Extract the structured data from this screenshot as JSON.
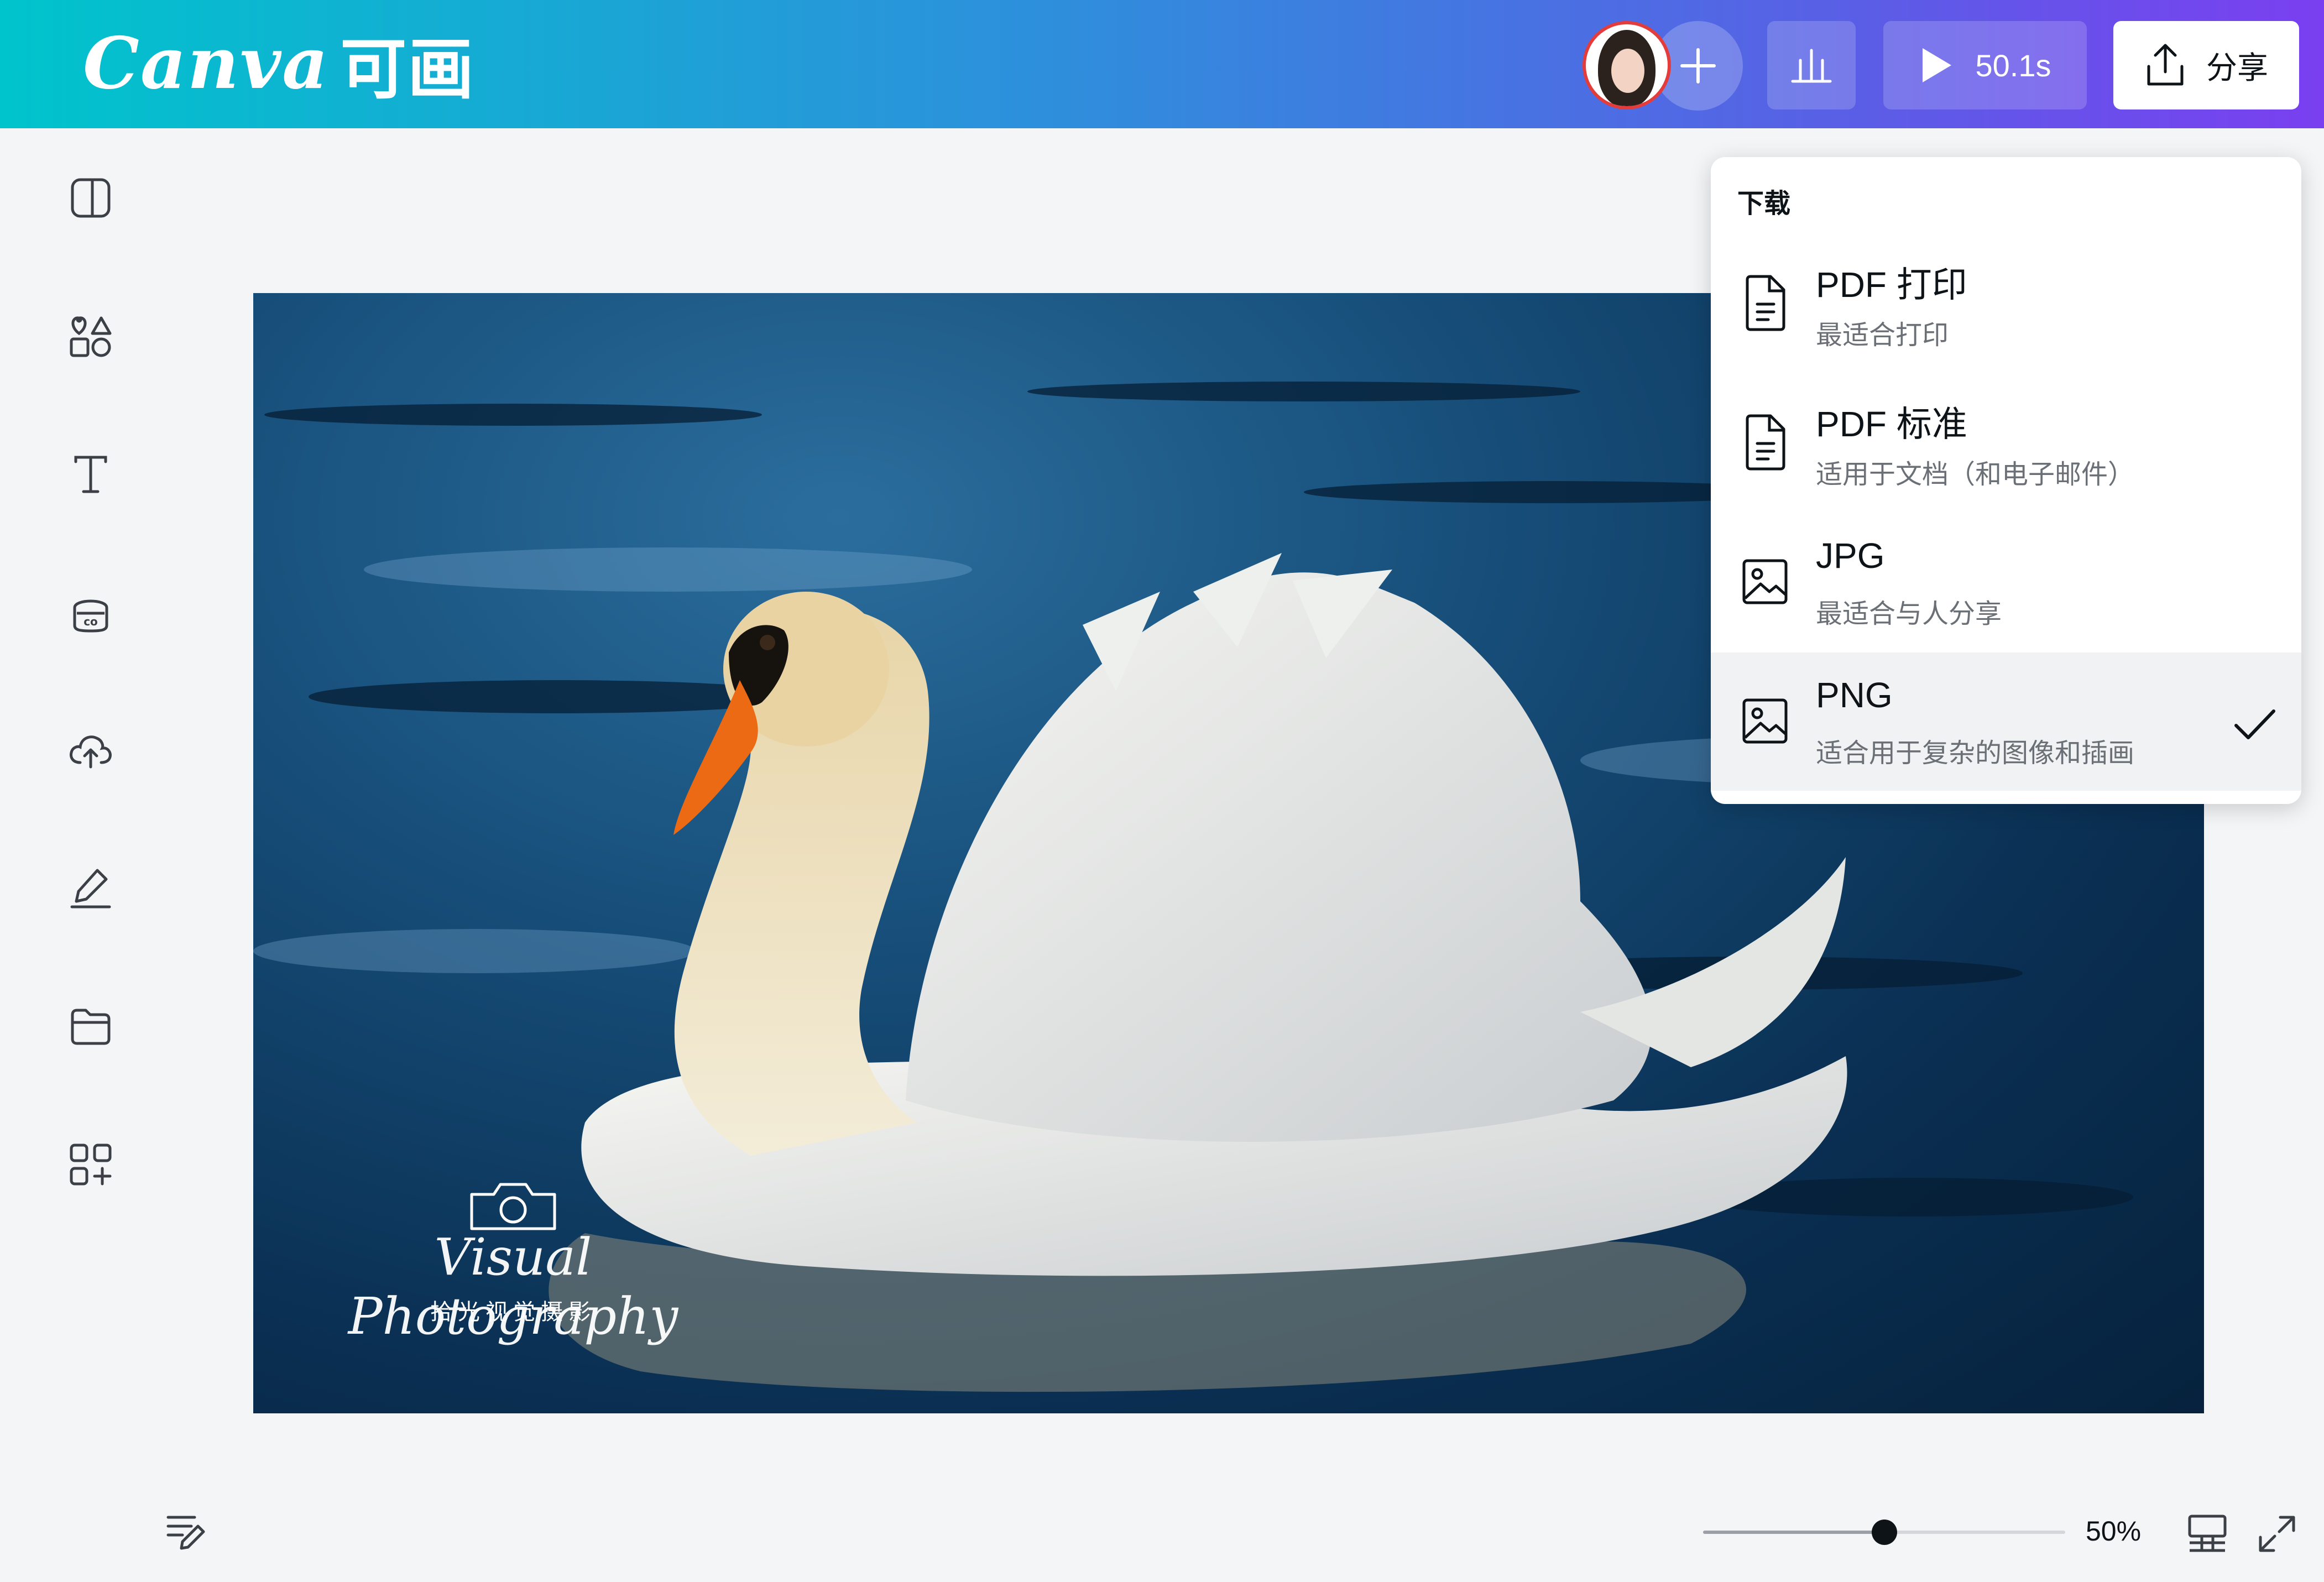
{
  "header": {
    "logo_text": "Canva",
    "logo_cn": "可画",
    "duration": "50.1s",
    "share_label": "分享",
    "icons": {
      "avatar": "user-avatar",
      "add_collaborator": "plus-icon",
      "stats": "bar-chart-icon",
      "play": "play-icon",
      "share": "upload-icon"
    }
  },
  "sidebar": {
    "items": [
      {
        "icon": "template-icon"
      },
      {
        "icon": "elements-icon"
      },
      {
        "icon": "text-icon"
      },
      {
        "icon": "brand-icon"
      },
      {
        "icon": "upload-cloud-icon"
      },
      {
        "icon": "draw-icon"
      },
      {
        "icon": "folder-icon"
      },
      {
        "icon": "apps-icon"
      }
    ]
  },
  "canvas": {
    "watermark_script": "Visual Photography",
    "watermark_cn": "拾光视觉摄影"
  },
  "download_menu": {
    "heading": "下载",
    "items": [
      {
        "title": "PDF 打印",
        "subtitle": "最适合打印",
        "icon": "document-icon",
        "selected": false
      },
      {
        "title": "PDF 标准",
        "subtitle": "适用于文档（和电子邮件）",
        "icon": "document-icon",
        "selected": false
      },
      {
        "title": "JPG",
        "subtitle": "最适合与人分享",
        "icon": "image-icon",
        "selected": false
      },
      {
        "title": "PNG",
        "subtitle": "适合用于复杂的图像和插画",
        "icon": "image-icon",
        "selected": true
      }
    ]
  },
  "footer": {
    "zoom_label": "50%",
    "zoom_level": 0.5,
    "icons": {
      "notes": "notes-icon",
      "view": "grid-view-icon",
      "fullscreen": "fullscreen-icon"
    }
  },
  "colors": {
    "header_gradient_start": "#00c4cc",
    "header_gradient_end": "#7a3ff0",
    "avatar_ring": "#e43b3b",
    "menu_selected_bg": "#f1f2f4"
  }
}
